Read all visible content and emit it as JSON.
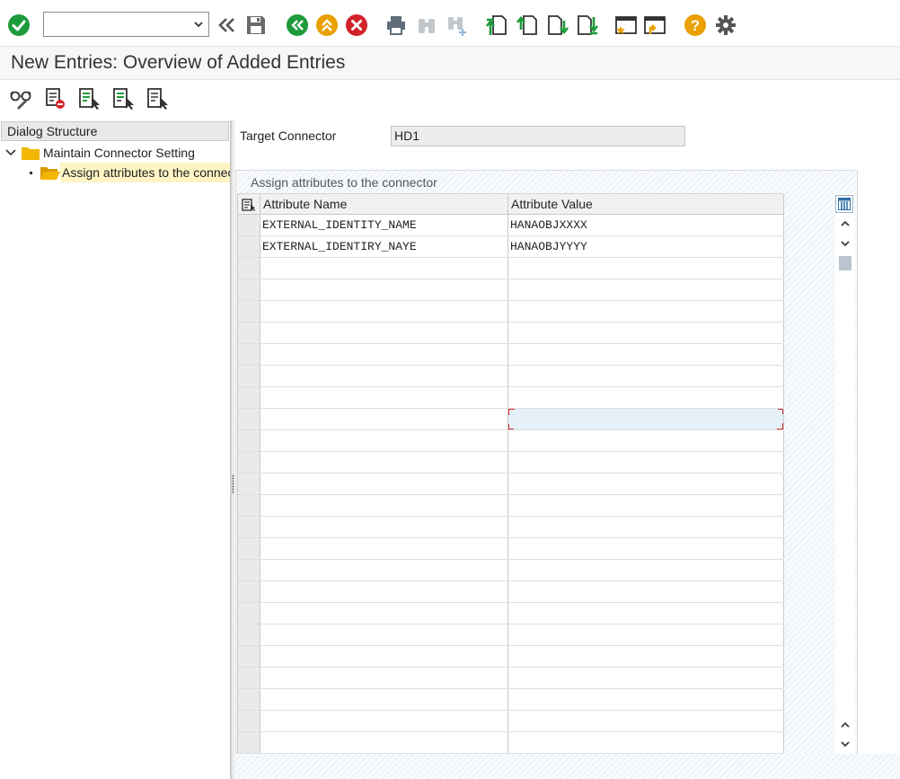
{
  "toolbar": {
    "command_field_value": "",
    "command_field_placeholder": "",
    "buttons": [
      "enter",
      "back",
      "save",
      "back-green",
      "exit",
      "cancel",
      "print",
      "find",
      "find-next",
      "first-page",
      "previous-page",
      "next-page",
      "last-page",
      "create-session",
      "generate-shortcut",
      "help",
      "customize-layout"
    ]
  },
  "title": "New Entries: Overview of Added Entries",
  "app_toolbar": {
    "buttons": [
      "change-display",
      "delete",
      "select-all",
      "select-block",
      "deselect-all"
    ]
  },
  "dialog_structure": {
    "header": "Dialog Structure",
    "items": [
      {
        "label": "Maintain Connector Setting",
        "level": 0,
        "expanded": true,
        "selected": false
      },
      {
        "label": "Assign attributes to the connector",
        "level": 1,
        "expanded": false,
        "selected": true
      }
    ]
  },
  "form": {
    "target_connector_label": "Target Connector",
    "target_connector_value": "HD1"
  },
  "table": {
    "group_title": "Assign attributes to the connector",
    "columns": [
      "Attribute Name",
      "Attribute Value"
    ],
    "rows": [
      [
        "EXTERNAL_IDENTITY_NAME",
        "HANAOBJXXXX"
      ],
      [
        "EXTERNAL_IDENTIRY_NAYE",
        "HANAOBJYYYY"
      ],
      [
        "",
        ""
      ],
      [
        "",
        ""
      ],
      [
        "",
        ""
      ],
      [
        "",
        ""
      ],
      [
        "",
        ""
      ],
      [
        "",
        ""
      ],
      [
        "",
        ""
      ],
      [
        "",
        ""
      ],
      [
        "",
        ""
      ],
      [
        "",
        ""
      ],
      [
        "",
        ""
      ],
      [
        "",
        ""
      ],
      [
        "",
        ""
      ],
      [
        "",
        ""
      ],
      [
        "",
        ""
      ],
      [
        "",
        ""
      ],
      [
        "",
        ""
      ],
      [
        "",
        ""
      ],
      [
        "",
        ""
      ],
      [
        "",
        ""
      ],
      [
        "",
        ""
      ],
      [
        "",
        ""
      ],
      [
        "",
        ""
      ]
    ],
    "focused_row": 9,
    "focused_col": 1
  },
  "colors": {
    "ok_green": "#1e9b3a",
    "nav_orange": "#e9a000",
    "cancel_red": "#d2232a",
    "folder_yellow": "#f3b600",
    "selection_yellow": "#fff5c4",
    "focus_red": "#d3282c"
  }
}
